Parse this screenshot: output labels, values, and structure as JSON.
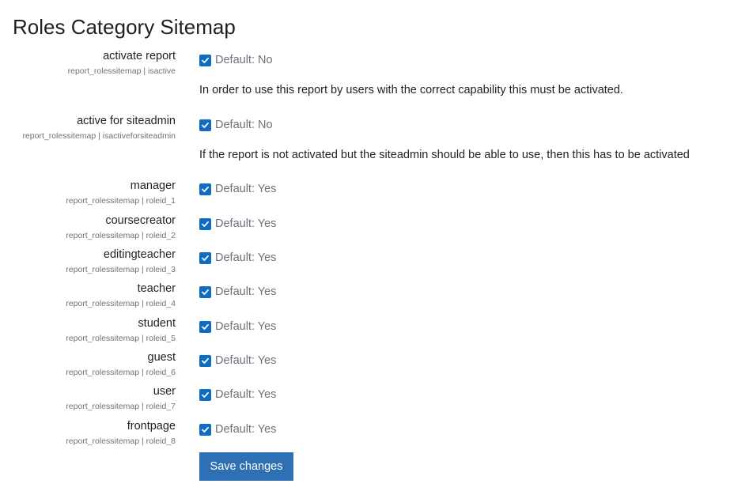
{
  "page": {
    "title": "Roles Category Sitemap"
  },
  "settings": [
    {
      "name": "activate report",
      "id": "report_rolessitemap | isactive",
      "checked": true,
      "default": "Default: No",
      "description": "In order to use this report by users with the correct capability this must be activated."
    },
    {
      "name": "active for siteadmin",
      "id": "report_rolessitemap | isactiveforsiteadmin",
      "checked": true,
      "default": "Default: No",
      "description": "If the report is not activated but the siteadmin should be able to use, then this has to be activated"
    },
    {
      "name": "manager",
      "id": "report_rolessitemap | roleid_1",
      "checked": true,
      "default": "Default: Yes"
    },
    {
      "name": "coursecreator",
      "id": "report_rolessitemap | roleid_2",
      "checked": true,
      "default": "Default: Yes"
    },
    {
      "name": "editingteacher",
      "id": "report_rolessitemap | roleid_3",
      "checked": true,
      "default": "Default: Yes"
    },
    {
      "name": "teacher",
      "id": "report_rolessitemap | roleid_4",
      "checked": true,
      "default": "Default: Yes"
    },
    {
      "name": "student",
      "id": "report_rolessitemap | roleid_5",
      "checked": true,
      "default": "Default: Yes"
    },
    {
      "name": "guest",
      "id": "report_rolessitemap | roleid_6",
      "checked": true,
      "default": "Default: Yes"
    },
    {
      "name": "user",
      "id": "report_rolessitemap | roleid_7",
      "checked": true,
      "default": "Default: Yes"
    },
    {
      "name": "frontpage",
      "id": "report_rolessitemap | roleid_8",
      "checked": true,
      "default": "Default: Yes"
    }
  ],
  "actions": {
    "save_label": "Save changes"
  },
  "colors": {
    "accent": "#0f6cbf",
    "button": "#2f6fb3",
    "muted_text": "#6a737b"
  },
  "icons": {
    "checkbox": "checkmark-icon"
  }
}
